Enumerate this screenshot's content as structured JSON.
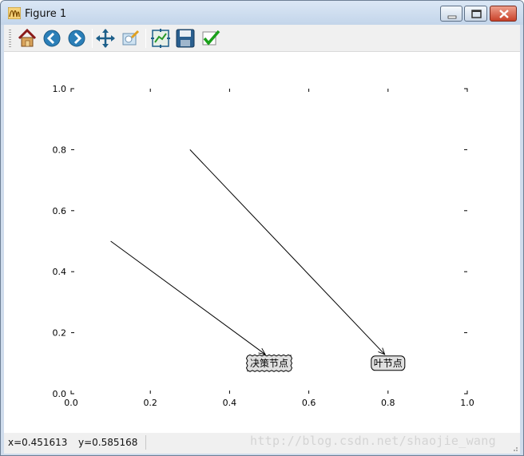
{
  "window": {
    "title": "Figure 1"
  },
  "toolbar": {
    "buttons": [
      {
        "name": "home-icon",
        "tooltip": "Home"
      },
      {
        "name": "back-icon",
        "tooltip": "Back"
      },
      {
        "name": "forward-icon",
        "tooltip": "Forward"
      },
      {
        "name": "pan-icon",
        "tooltip": "Pan"
      },
      {
        "name": "zoom-icon",
        "tooltip": "Zoom"
      },
      {
        "name": "subplots-icon",
        "tooltip": "Subplots"
      },
      {
        "name": "save-icon",
        "tooltip": "Save"
      },
      {
        "name": "edit-axis-icon",
        "tooltip": "Edit"
      }
    ]
  },
  "status": {
    "x_readout": "x=0.451613",
    "y_readout": "y=0.585168"
  },
  "watermark": "http://blog.csdn.net/shaojie_wang",
  "chart_data": {
    "type": "scatter",
    "title": "",
    "xlabel": "",
    "ylabel": "",
    "xlim": [
      0.0,
      1.0
    ],
    "ylim": [
      0.0,
      1.0
    ],
    "xticks": [
      "0.0",
      "0.2",
      "0.4",
      "0.6",
      "0.8",
      "1.0"
    ],
    "yticks": [
      "0.0",
      "0.2",
      "0.4",
      "0.6",
      "0.8",
      "1.0"
    ],
    "grid": false,
    "annotations": [
      {
        "text": "决策节点",
        "xy": [
          0.1,
          0.5
        ],
        "xytext": [
          0.5,
          0.1
        ],
        "box": "sawtooth",
        "box_color": "#e0e0e0"
      },
      {
        "text": "叶节点",
        "xy": [
          0.3,
          0.8
        ],
        "xytext": [
          0.8,
          0.1
        ],
        "box": "round4",
        "box_color": "#e0e0e0"
      }
    ]
  }
}
